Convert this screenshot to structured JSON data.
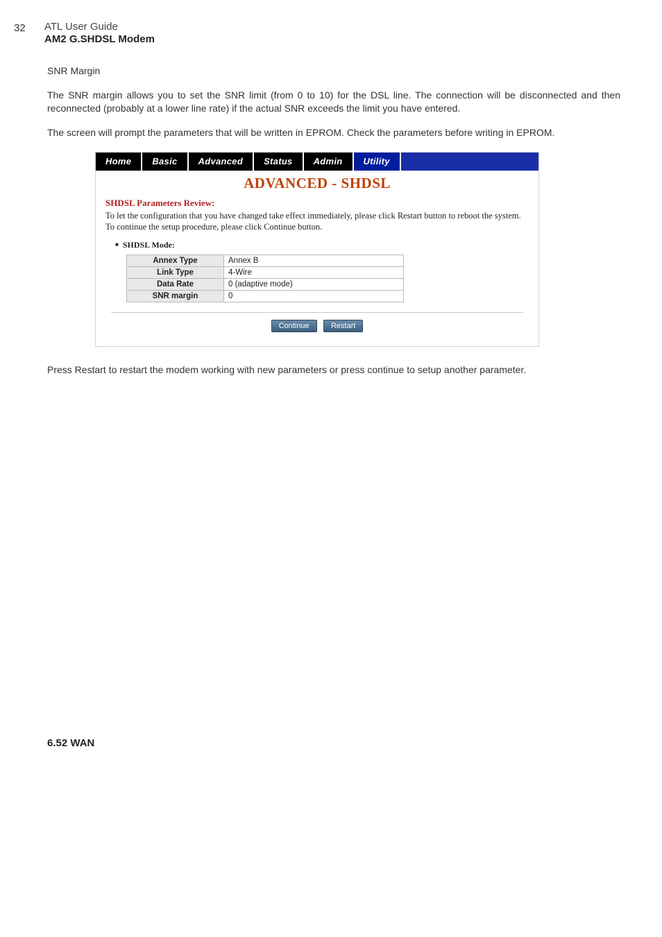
{
  "page_number": "32",
  "doc_subtitle": "ATL User Guide",
  "doc_title": "AM2 G.SHDSL Modem",
  "snr_heading": "SNR Margin",
  "para1": "The SNR margin allows you to set the SNR limit (from 0 to 10) for the DSL line. The connection will be disconnected and then reconnected (probably at a lower line rate) if the actual SNR exceeds the limit you have entered.",
  "para2": "The screen will prompt the parameters that will be written in EPROM. Check the parameters before writing in EPROM.",
  "nav": {
    "home": "Home",
    "basic": "Basic",
    "advanced": "Advanced",
    "status": "Status",
    "admin": "Admin",
    "utility": "Utility"
  },
  "panel": {
    "title": "ADVANCED - SHDSL",
    "review_heading": "SHDSL Parameters Review:",
    "review_text": "To let the configuration that you have changed take effect immediately,  please click Restart button to reboot the system.  To continue the setup procedure, please click Continue button.",
    "mode_label": "SHDSL Mode:",
    "rows": {
      "annex_label": "Annex Type",
      "annex_value": "Annex B",
      "link_label": "Link Type",
      "link_value": "4-Wire",
      "rate_label": "Data Rate",
      "rate_value": "0  (adaptive mode)",
      "snr_label": "SNR margin",
      "snr_value": "0"
    },
    "continue_btn": "Continue",
    "restart_btn": "Restart"
  },
  "after_para": "Press Restart to restart the modem working with new parameters or press continue to setup another parameter.",
  "section_head": "6.52   WAN"
}
